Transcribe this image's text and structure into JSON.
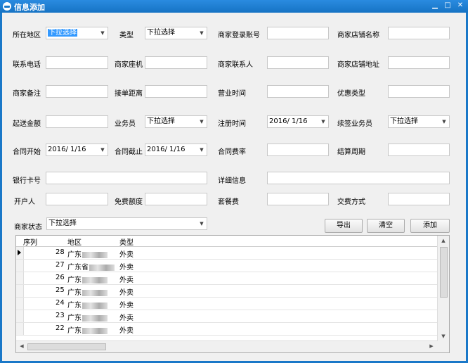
{
  "window": {
    "title": "信息添加"
  },
  "form": {
    "region_label": "所在地区",
    "region_value": "下拉选择",
    "type_label": "类型",
    "type_value": "下拉选择",
    "merchant_account_label": "商家登录账号",
    "store_name_label": "商家店铺名称",
    "phone_label": "联系电话",
    "landline_label": "商家座机",
    "contact_label": "商家联系人",
    "store_address_label": "商家店铺地址",
    "remark_label": "商家备注",
    "order_distance_label": "接单距离",
    "business_hours_label": "营业时间",
    "promo_type_label": "优惠类型",
    "min_order_label": "起送金额",
    "salesman_label": "业务员",
    "salesman_value": "下拉选择",
    "register_time_label": "注册时间",
    "register_time_value": "2016/  1/16",
    "renew_salesman_label": "续签业务员",
    "renew_salesman_value": "下拉选择",
    "contract_start_label": "合同开始",
    "contract_start_value": "2016/  1/16",
    "contract_end_label": "合同截止",
    "contract_end_value": "2016/  1/16",
    "contract_rate_label": "合同费率",
    "settle_period_label": "结算周期",
    "bank_card_label": "银行卡号",
    "detail_label": "详细信息",
    "account_holder_label": "开户人",
    "free_quota_label": "免费额度",
    "package_fee_label": "套餐费",
    "payment_method_label": "交费方式",
    "merchant_status_label": "商家状态",
    "merchant_status_value": "下拉选择"
  },
  "buttons": {
    "export": "导出",
    "clear": "清空",
    "add": "添加"
  },
  "table": {
    "headers": [
      "序列",
      "地区",
      "类型"
    ],
    "rows": [
      {
        "seq": "28",
        "region": "广东",
        "type": "外卖"
      },
      {
        "seq": "27",
        "region": "广东省",
        "type": "外卖"
      },
      {
        "seq": "26",
        "region": "广东",
        "type": "外卖"
      },
      {
        "seq": "25",
        "region": "广东",
        "type": "外卖"
      },
      {
        "seq": "24",
        "region": "广东",
        "type": "外卖"
      },
      {
        "seq": "23",
        "region": "广东",
        "type": "外卖"
      },
      {
        "seq": "22",
        "region": "广东",
        "type": "外卖"
      }
    ]
  },
  "icons": {
    "dropdown": "chevron-down-icon",
    "minimize": "minimize-icon",
    "maximize": "maximize-icon",
    "close": "close-icon"
  },
  "colors": {
    "titlebar": "#1a78c8",
    "selection": "#3399ff"
  }
}
